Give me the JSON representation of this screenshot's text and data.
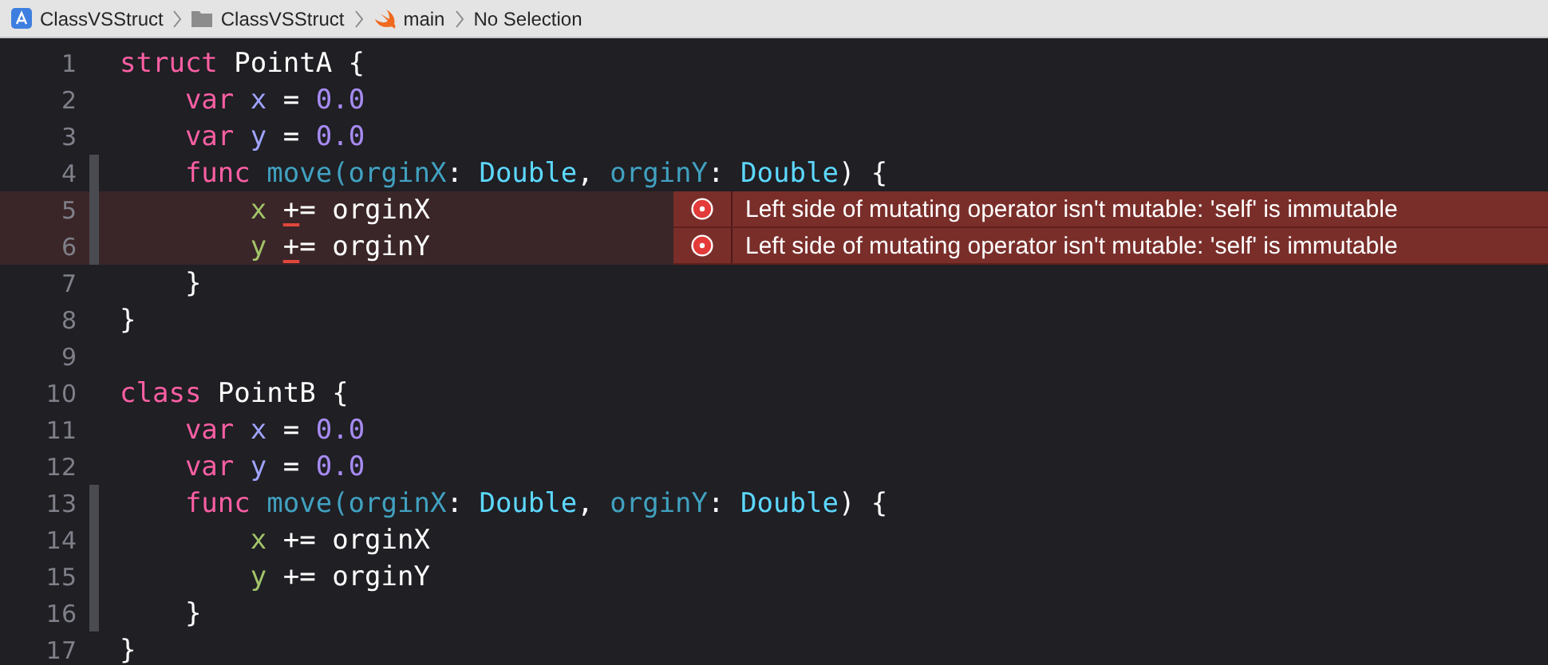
{
  "breadcrumb": [
    {
      "kind": "app",
      "label": "ClassVSStruct"
    },
    {
      "kind": "folder",
      "label": "ClassVSStruct"
    },
    {
      "kind": "swift",
      "label": "main"
    },
    {
      "kind": "none",
      "label": "No Selection"
    }
  ],
  "lines": [
    {
      "number": "1",
      "changed": false,
      "tokens": [
        {
          "kind": "keyword",
          "text": "struct"
        },
        {
          "kind": "plain",
          "text": " PointA {"
        }
      ]
    },
    {
      "number": "2",
      "changed": false,
      "tokens": [
        {
          "kind": "keyword",
          "text": "    var"
        },
        {
          "kind": "property",
          "text": " x"
        },
        {
          "kind": "plain",
          "text": " = "
        },
        {
          "kind": "number",
          "text": "0.0"
        }
      ]
    },
    {
      "number": "3",
      "changed": false,
      "tokens": [
        {
          "kind": "keyword",
          "text": "    var"
        },
        {
          "kind": "property",
          "text": " y"
        },
        {
          "kind": "plain",
          "text": " = "
        },
        {
          "kind": "number",
          "text": "0.0"
        }
      ]
    },
    {
      "number": "4",
      "changed": true,
      "tokens": [
        {
          "kind": "keyword",
          "text": "    func"
        },
        {
          "kind": "function",
          "text": " move(orginX"
        },
        {
          "kind": "plain",
          "text": ": "
        },
        {
          "kind": "type",
          "text": "Double"
        },
        {
          "kind": "plain",
          "text": ", "
        },
        {
          "kind": "function",
          "text": "orginY"
        },
        {
          "kind": "plain",
          "text": ": "
        },
        {
          "kind": "type",
          "text": "Double"
        },
        {
          "kind": "plain",
          "text": ") {"
        }
      ]
    },
    {
      "number": "5",
      "changed": true,
      "error": "Left side of mutating operator isn't mutable: 'self' is immutable",
      "tokens": [
        {
          "kind": "reference",
          "text": "        x "
        },
        {
          "kind": "flagged",
          "text": "+"
        },
        {
          "kind": "plain",
          "text": "= orginX"
        }
      ]
    },
    {
      "number": "6",
      "changed": true,
      "error": "Left side of mutating operator isn't mutable: 'self' is immutable",
      "tokens": [
        {
          "kind": "reference",
          "text": "        y "
        },
        {
          "kind": "flagged",
          "text": "+"
        },
        {
          "kind": "plain",
          "text": "= orginY"
        }
      ]
    },
    {
      "number": "7",
      "changed": false,
      "tokens": [
        {
          "kind": "plain",
          "text": "    }"
        }
      ]
    },
    {
      "number": "8",
      "changed": false,
      "tokens": [
        {
          "kind": "plain",
          "text": "}"
        }
      ]
    },
    {
      "number": "9",
      "changed": false
    },
    {
      "number": "10",
      "changed": false,
      "tokens": [
        {
          "kind": "keyword",
          "text": "class"
        },
        {
          "kind": "plain",
          "text": " PointB {"
        }
      ]
    },
    {
      "number": "11",
      "changed": false,
      "tokens": [
        {
          "kind": "keyword",
          "text": "    var"
        },
        {
          "kind": "property",
          "text": " x"
        },
        {
          "kind": "plain",
          "text": " = "
        },
        {
          "kind": "number",
          "text": "0.0"
        }
      ]
    },
    {
      "number": "12",
      "changed": false,
      "tokens": [
        {
          "kind": "keyword",
          "text": "    var"
        },
        {
          "kind": "property",
          "text": " y"
        },
        {
          "kind": "plain",
          "text": " = "
        },
        {
          "kind": "number",
          "text": "0.0"
        }
      ]
    },
    {
      "number": "13",
      "changed": true,
      "tokens": [
        {
          "kind": "keyword",
          "text": "    func"
        },
        {
          "kind": "function",
          "text": " move(orginX"
        },
        {
          "kind": "plain",
          "text": ": "
        },
        {
          "kind": "type",
          "text": "Double"
        },
        {
          "kind": "plain",
          "text": ", "
        },
        {
          "kind": "function",
          "text": "orginY"
        },
        {
          "kind": "plain",
          "text": ": "
        },
        {
          "kind": "type",
          "text": "Double"
        },
        {
          "kind": "plain",
          "text": ") {"
        }
      ]
    },
    {
      "number": "14",
      "changed": true,
      "tokens": [
        {
          "kind": "reference",
          "text": "        x"
        },
        {
          "kind": "plain",
          "text": " += orginX"
        }
      ]
    },
    {
      "number": "15",
      "changed": true,
      "tokens": [
        {
          "kind": "reference",
          "text": "        y"
        },
        {
          "kind": "plain",
          "text": " += orginY"
        }
      ]
    },
    {
      "number": "16",
      "changed": true,
      "tokens": [
        {
          "kind": "plain",
          "text": "    }"
        }
      ]
    },
    {
      "number": "17",
      "changed": false,
      "tokens": [
        {
          "kind": "plain",
          "text": "}"
        }
      ]
    }
  ]
}
